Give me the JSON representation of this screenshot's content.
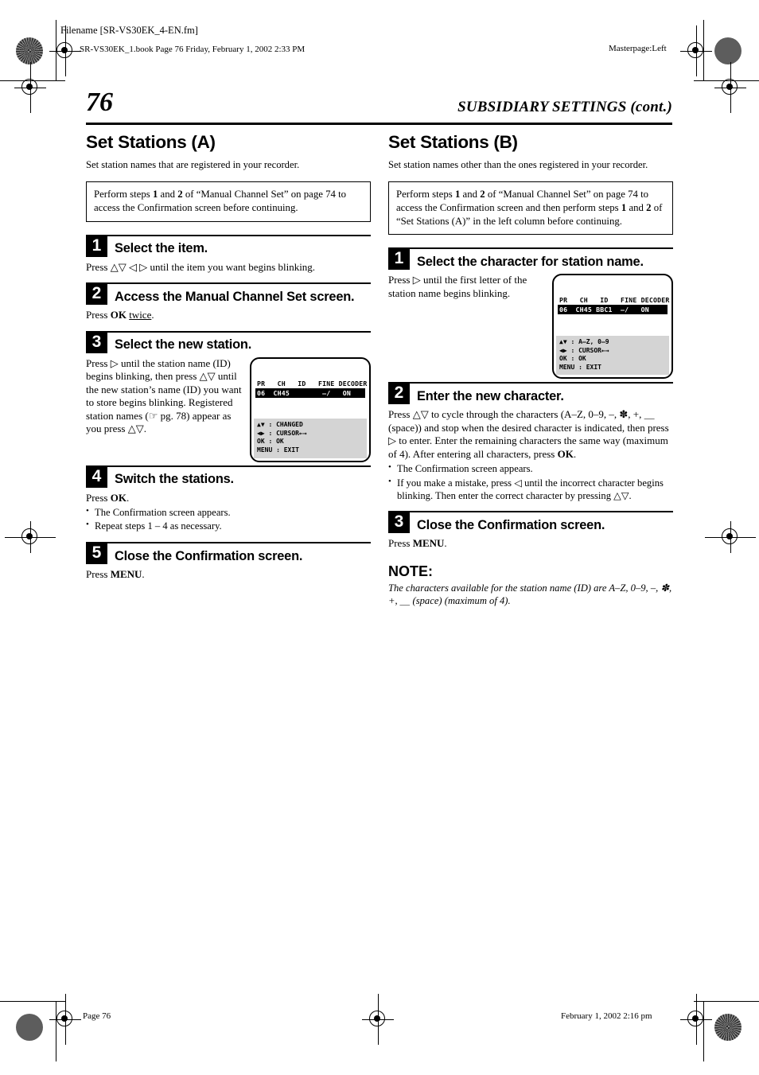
{
  "page_meta": {
    "filename_label": "Filename [SR-VS30EK_4-EN.fm]",
    "book_line": "SR-VS30EK_1.book  Page 76  Friday, February 1, 2002  2:33 PM",
    "masterpage": "Masterpage:Left",
    "footer_page": "Page 76",
    "footer_date": "February 1, 2002 2:16 pm"
  },
  "header": {
    "page_number": "76",
    "chapter_title": "SUBSIDIARY SETTINGS (cont.)"
  },
  "left_column": {
    "section_title": "Set Stations (A)",
    "lede": "Set station names that are registered in your recorder.",
    "callout": "Perform steps 1 and 2 of “Manual Channel Set” on page 74 to access the Confirmation screen before continuing.",
    "callout_parts": {
      "p1": "Perform steps ",
      "b1": "1",
      "p2": " and ",
      "b2": "2",
      "p3": " of “Manual Channel Set” on page 74 to access the Confirmation screen before continuing."
    },
    "steps": [
      {
        "number": "1",
        "title": "Select the item.",
        "body": "Press △▽ ◁ ▷ until the item you want begins blinking."
      },
      {
        "number": "2",
        "title": "Access the Manual Channel Set screen.",
        "body_pre": "Press ",
        "body_bold": "OK",
        "body_underline": "twice",
        "body_post": "."
      },
      {
        "number": "3",
        "title": "Select the new station.",
        "body": "Press ▷ until the station name (ID) begins blinking, then press △▽ until the new station’s name (ID) you want to store begins blinking. Registered station names (☞ pg. 78) appear as you press △▽."
      },
      {
        "number": "4",
        "title": "Switch the stations.",
        "body_pre": "Press ",
        "body_bold": "OK",
        "body_post": ".",
        "bullets": [
          "The Confirmation screen appears.",
          "Repeat steps 1 – 4 as necessary."
        ]
      },
      {
        "number": "5",
        "title": "Close the Confirmation screen.",
        "body_pre": "Press ",
        "body_bold": "MENU",
        "body_post": "."
      }
    ],
    "lcd": {
      "header_row": "PR   CH   ID   FINE DECODER",
      "data_row": "06  CH45        –/   ON",
      "legend": [
        "▲▼ : CHANGED",
        "◀▶ : CURSOR←→",
        "OK : OK",
        "MENU : EXIT"
      ]
    }
  },
  "right_column": {
    "section_title": "Set Stations (B)",
    "lede": "Set station names other than the ones registered in your recorder.",
    "callout_parts": {
      "p1": "Perform steps ",
      "b1": "1",
      "p2": " and ",
      "b2": "2",
      "p3": " of “Manual Channel Set” on page 74 to access the Confirmation screen and then perform steps ",
      "b3": "1",
      "p4": " and ",
      "b4": "2",
      "p5": " of “Set Stations (A)” in the left column before continuing."
    },
    "steps": [
      {
        "number": "1",
        "title": "Select the character for station name.",
        "body": "Press ▷ until the first letter of the station name begins blinking."
      },
      {
        "number": "2",
        "title": "Enter the new character.",
        "body_pre": "Press △▽ to cycle through the characters (A–Z, 0–9, –, ✽, +, ＿ (space)) and stop when the desired character is indicated, then press ▷ to enter. Enter the remaining characters the same way (maximum of 4). After entering all characters, press ",
        "body_bold": "OK",
        "body_post": ".",
        "bullets": [
          "The Confirmation screen appears.",
          "If you make a mistake, press ◁ until the incorrect character begins blinking. Then enter the correct character by pressing △▽."
        ]
      },
      {
        "number": "3",
        "title": "Close the Confirmation screen.",
        "body_pre": "Press ",
        "body_bold": "MENU",
        "body_post": "."
      }
    ],
    "lcd": {
      "header_row": "PR   CH   ID   FINE DECODER",
      "data_row": "06  CH45 BBC1  –/   ON",
      "legend": [
        "▲▼ : A–Z, 0–9",
        "◀▶ : CURSOR←→",
        "OK : OK",
        "MENU : EXIT"
      ]
    },
    "note": {
      "heading": "NOTE:",
      "body": "The characters available for the station name (ID) are A–Z, 0–9, –, ✽, +, ＿ (space) (maximum of 4)."
    }
  }
}
